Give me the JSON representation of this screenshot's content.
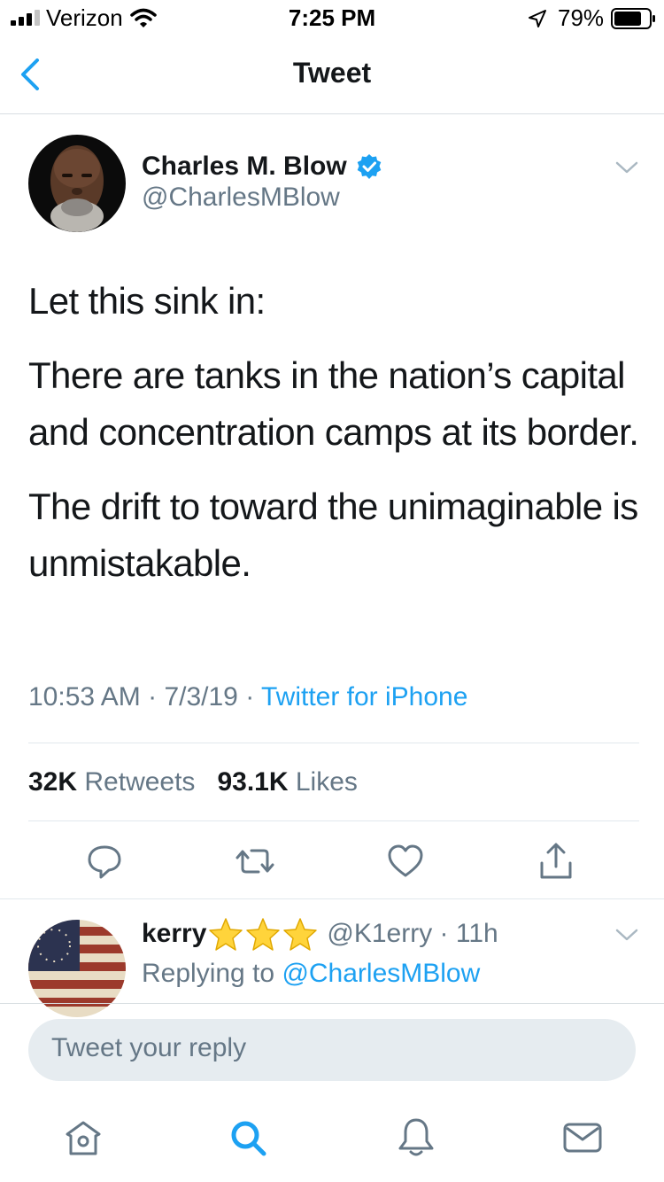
{
  "status_bar": {
    "carrier": "Verizon",
    "time": "7:25 PM",
    "battery": "79%",
    "battery_level": 0.79
  },
  "nav": {
    "title": "Tweet",
    "back_icon": "chevron-left-icon"
  },
  "tweet": {
    "display_name": "Charles M. Blow",
    "handle": "@CharlesMBlow",
    "paragraphs": [
      "Let this sink in:",
      "There are tanks in the nation’s capital and concentration camps at its border.",
      "The drift to toward the unimaginable is unmistakable."
    ],
    "time": "10:53 AM",
    "date": "7/3/19",
    "sep": " · ",
    "source": "Twitter for iPhone",
    "retweets_count": "32K",
    "retweets_label": " Retweets",
    "likes_count": "93.1K",
    "likes_label": " Likes"
  },
  "reply": {
    "display_name": "kerry",
    "handle_time": "@K1erry · 11h",
    "replying_prefix": "Replying to ",
    "replying_to": "@CharlesMBlow"
  },
  "compose": {
    "placeholder": "Tweet your reply"
  },
  "tab_bar": {
    "items": [
      "home-icon",
      "search-icon",
      "notifications-icon",
      "messages-icon"
    ]
  },
  "colors": {
    "accent": "#1da1f2",
    "secondary_text": "#657786",
    "compose_bg": "#e6ecf0"
  }
}
